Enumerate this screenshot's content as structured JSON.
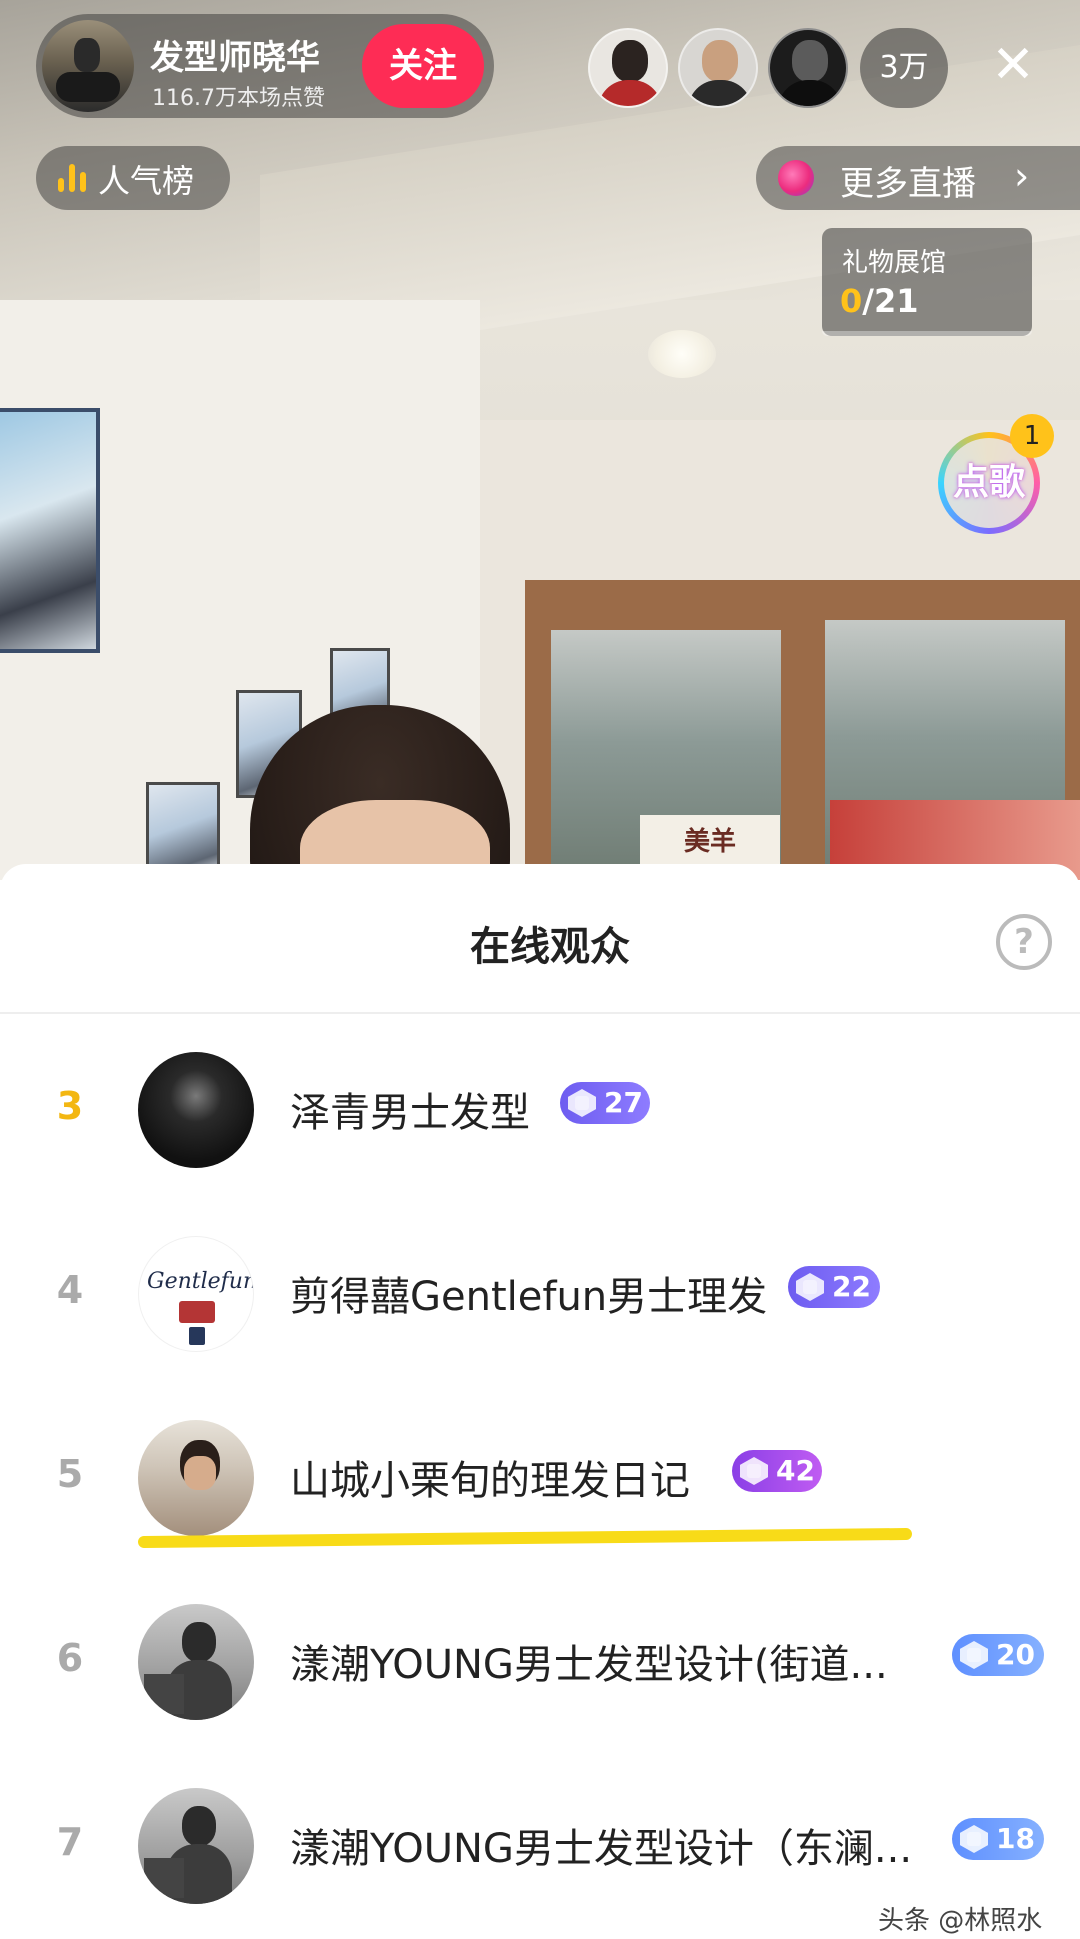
{
  "host": {
    "name": "发型师晓华",
    "stats": "116.7万本场点赞",
    "follow_label": "关注"
  },
  "viewer_count": "3万",
  "close_icon": "close-icon",
  "rank_label": "人气榜",
  "more_live_label": "更多直播",
  "gift_hall": {
    "title": "礼物展馆",
    "collected": "0",
    "total": "/21",
    "progress": 0
  },
  "song_request": {
    "label": "点歌",
    "badge": "1"
  },
  "sheet": {
    "title": "在线观众",
    "help_icon": "?",
    "viewers": [
      {
        "rank": "3",
        "name": "泽青男士发型",
        "level": "27",
        "badge_color": "#7a68f7"
      },
      {
        "rank": "4",
        "name": "剪得囍Gentlefun男士理发",
        "level": "22",
        "badge_color": "#7a68f7"
      },
      {
        "rank": "5",
        "name": "山城小栗旬的理发日记",
        "level": "42",
        "badge_color": "#a04de9"
      },
      {
        "rank": "6",
        "name": "漾潮YOUNG男士发型设计(街道...",
        "level": "20",
        "badge_color": "#6e9bff"
      },
      {
        "rank": "7",
        "name": "漾潮YOUNG男士发型设计（东澜...",
        "level": "18",
        "badge_color": "#6e9bff"
      }
    ]
  },
  "logo_text": "Gentlefun",
  "watermark": "头条 @林照水",
  "colors": {
    "follow": "#fe2c55",
    "accent_yellow": "#ffc21a",
    "top3_rank": "#f3b712",
    "highlight_underline": "#f8db18"
  }
}
